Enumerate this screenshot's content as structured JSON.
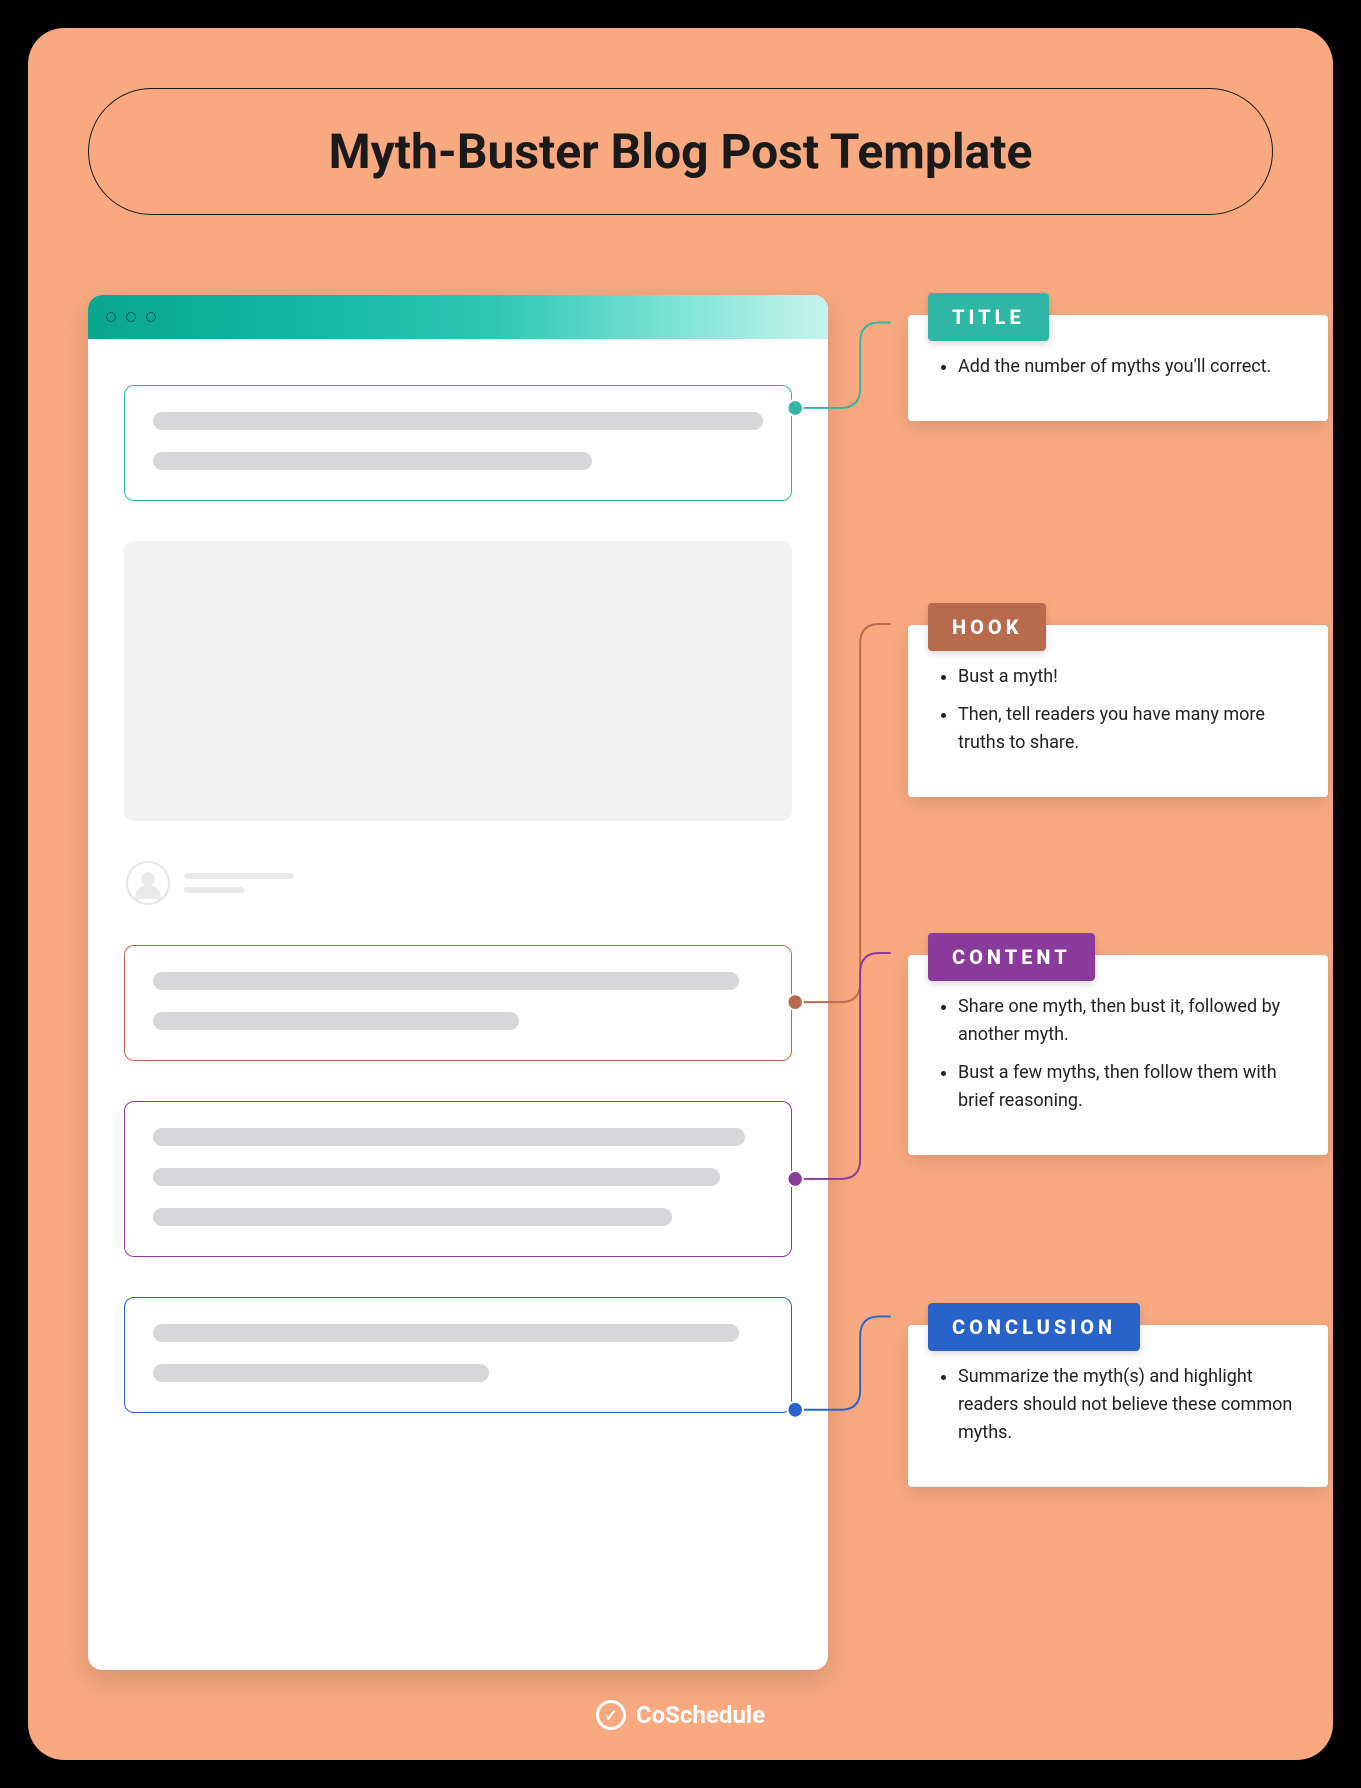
{
  "header": {
    "title": "Myth-Buster Blog Post Template"
  },
  "sections": {
    "title": {
      "label": "TITLE",
      "color": "#2fb6a4",
      "bullets": [
        "Add the number of myths you'll correct."
      ]
    },
    "hook": {
      "label": "HOOK",
      "color": "#b86b4c",
      "bullets": [
        "Bust a myth!",
        "Then, tell readers you have many more truths to share."
      ]
    },
    "content": {
      "label": "CONTENT",
      "color": "#8a3a9a",
      "bullets": [
        "Share one myth, then bust it, followed by another myth.",
        "Bust a few myths, then follow them with brief reasoning."
      ]
    },
    "conclusion": {
      "label": "CONCLUSION",
      "color": "#2763c9",
      "bullets": [
        "Summarize the myth(s) and highlight readers should not believe these common myths."
      ]
    }
  },
  "brand": {
    "name": "CoSchedule"
  }
}
